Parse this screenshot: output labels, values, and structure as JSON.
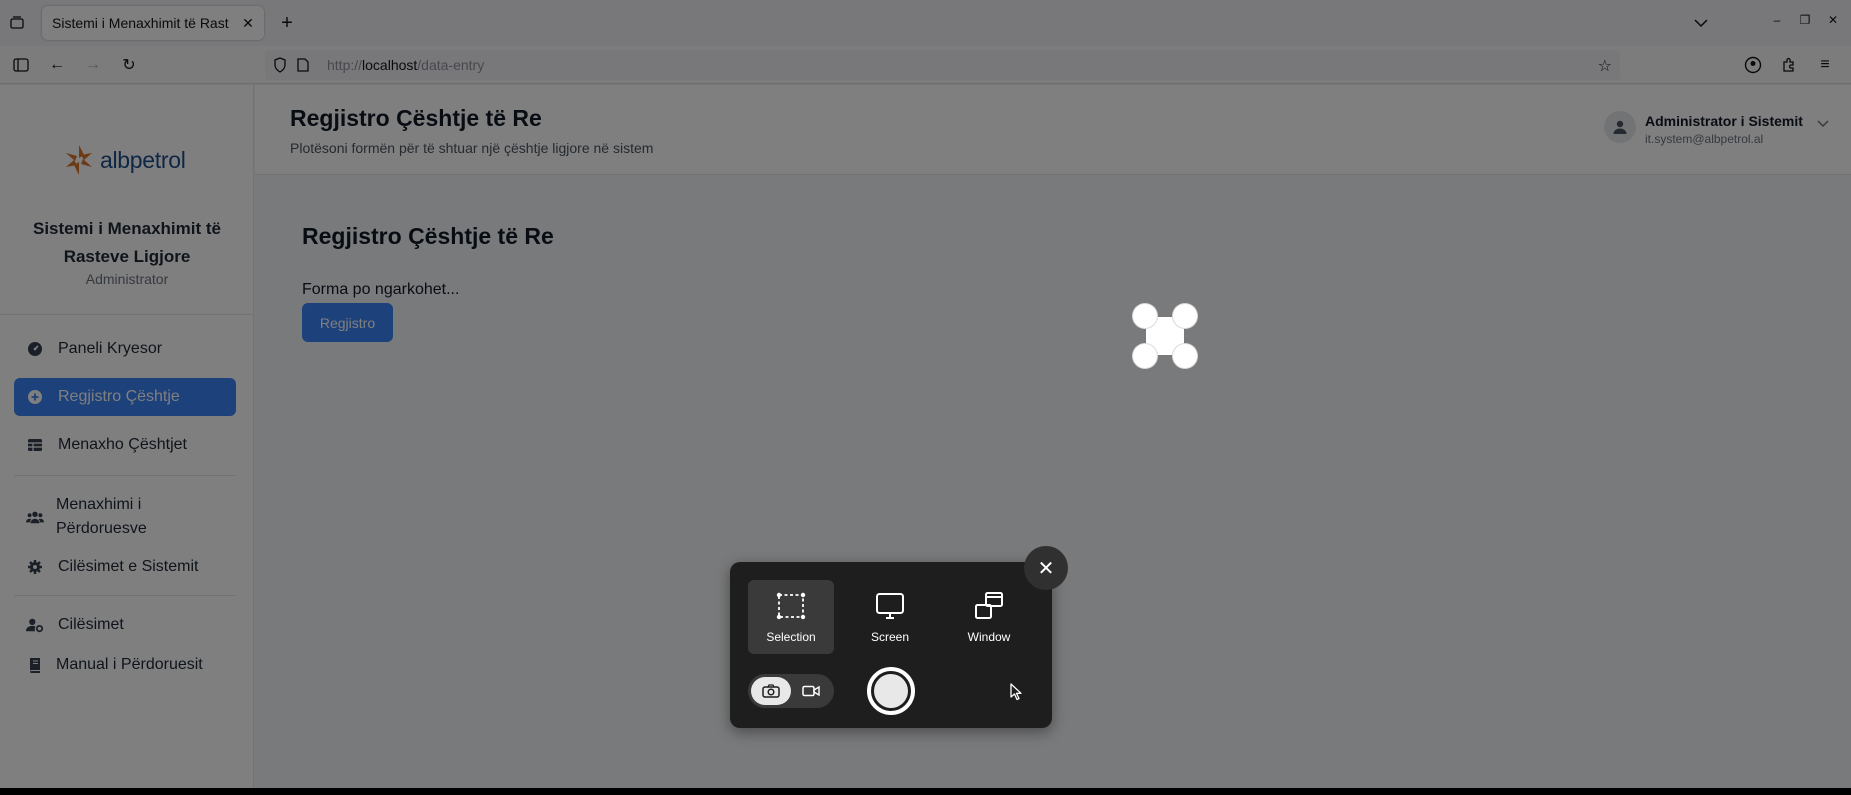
{
  "browser": {
    "tab_title": "Sistemi i Menaxhimit të Rast",
    "url_prefix": "http://",
    "url_host": "localhost",
    "url_path": "/data-entry"
  },
  "sidebar": {
    "logo_text": "albpetrol",
    "system_title": "Sistemi i Menaxhimit të Rasteve Ligjore",
    "role": "Administrator",
    "items": [
      {
        "label": "Paneli Kryesor",
        "icon": "dashboard-icon"
      },
      {
        "label": "Regjistro Çështje",
        "icon": "plus-circle-icon",
        "active": true
      },
      {
        "label": "Menaxho Çështjet",
        "icon": "table-icon"
      },
      {
        "label": "Menaxhimi i Përdoruesve",
        "icon": "users-icon"
      },
      {
        "label": "Cilësimet e Sistemit",
        "icon": "gear-icon"
      },
      {
        "label": "Cilësimet",
        "icon": "user-gear-icon"
      },
      {
        "label": "Manual i Përdoruesit",
        "icon": "book-icon"
      }
    ]
  },
  "header": {
    "title": "Regjistro Çështje të Re",
    "subtitle": "Plotësoni formën për të shtuar një çështje ligjore në sistem",
    "user_name": "Administrator i Sistemit",
    "user_email": "it.system@albpetrol.al"
  },
  "main": {
    "title": "Regjistro Çështje të Re",
    "loading_text": "Forma po ngarkohet...",
    "submit_label": "Regjistro"
  },
  "screenshot_tool": {
    "modes": [
      {
        "label": "Selection",
        "active": true
      },
      {
        "label": "Screen",
        "active": false
      },
      {
        "label": "Window",
        "active": false
      }
    ],
    "capture_type": "screenshot"
  },
  "colors": {
    "accent": "#3b82f6",
    "brand": "#1f4e8c",
    "logo_orange": "#d9752b"
  }
}
